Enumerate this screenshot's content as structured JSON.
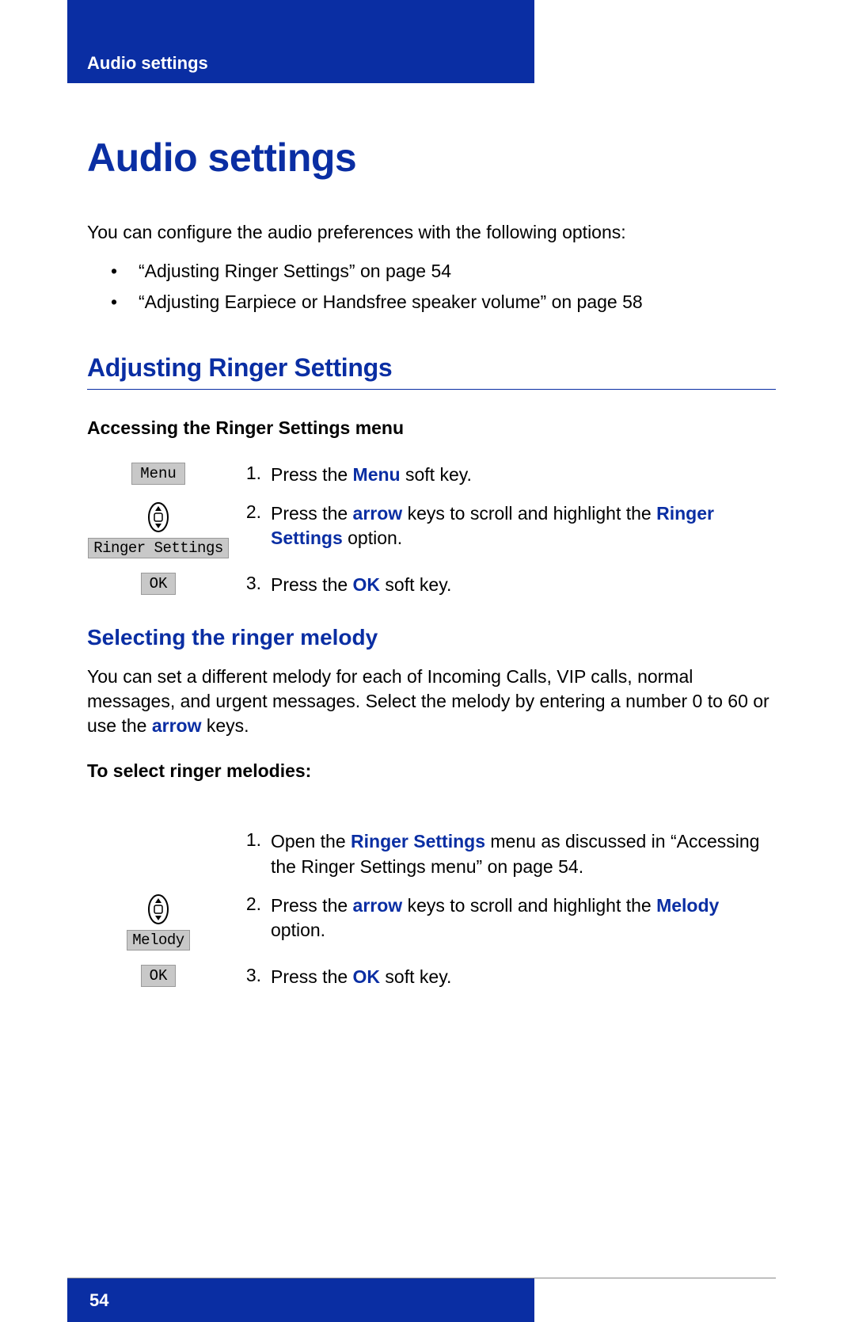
{
  "header": {
    "running_head": "Audio settings"
  },
  "title": "Audio settings",
  "intro": "You can configure the audio preferences with the following options:",
  "bullets": [
    "“Adjusting Ringer Settings” on page 54",
    "“Adjusting Earpiece or Handsfree speaker volume” on page 58"
  ],
  "section1": {
    "heading": "Adjusting Ringer Settings",
    "sub_heading": "Accessing the Ringer Settings menu",
    "icons": {
      "menu": "Menu",
      "ringer": "Ringer Settings",
      "ok": "OK"
    },
    "steps": [
      {
        "num": "1.",
        "pre": "Press the ",
        "kw": "Menu",
        "post": " soft key."
      },
      {
        "num": "2.",
        "pre": "Press the ",
        "kw": "arrow",
        "mid": " keys to scroll and highlight the ",
        "kw2": "Ringer Settings",
        "post": " option."
      },
      {
        "num": "3.",
        "pre": "Press the ",
        "kw": "OK",
        "post": " soft key."
      }
    ]
  },
  "section2": {
    "heading": "Selecting the ringer melody",
    "para_pre": "You can set a different melody for each of Incoming Calls, VIP calls, normal messages, and urgent messages. Select the melody by entering a number 0 to 60 or use the ",
    "para_kw": "arrow",
    "para_post": " keys.",
    "sub_heading": "To select ringer melodies:",
    "icons": {
      "melody": "Melody",
      "ok": "OK"
    },
    "steps": [
      {
        "num": "1.",
        "pre": "Open the ",
        "kw": "Ringer Settings",
        "post": " menu as discussed in “Accessing the Ringer Settings menu” on page 54."
      },
      {
        "num": "2.",
        "pre": "Press the ",
        "kw": "arrow",
        "mid": " keys to scroll and highlight the ",
        "kw2": "Melody",
        "post": " option."
      },
      {
        "num": "3.",
        "pre": "Press the ",
        "kw": "OK",
        "post": " soft key."
      }
    ]
  },
  "footer": {
    "page": "54"
  }
}
